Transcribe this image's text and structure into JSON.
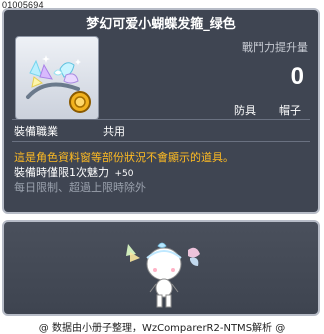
{
  "item_id": "01005694",
  "tooltip": {
    "title": "梦幻可爱小蝴蝶发箍_绿色",
    "stat_label": "戰鬥力提升量",
    "stat_value": "0",
    "category_primary": "防具",
    "category_secondary": "帽子",
    "job_label": "裝備職業",
    "job_value": "共用",
    "warning": "這是角色資料窗等部份狀況不會顯示的道具。",
    "equip_limit_label": "裝備時僅限1次魅力",
    "equip_limit_value": "+50",
    "trade_note": "每日限制、超過上限時除外"
  },
  "footer": {
    "credit": "@ 数据由小册子整理，WzComparerR2-NTMS解析 @"
  },
  "colors": {
    "panel_bg": "#3f4552",
    "panel_border": "#b7bcc7",
    "warning": "#ffbb22",
    "muted": "#9aa1ad"
  }
}
